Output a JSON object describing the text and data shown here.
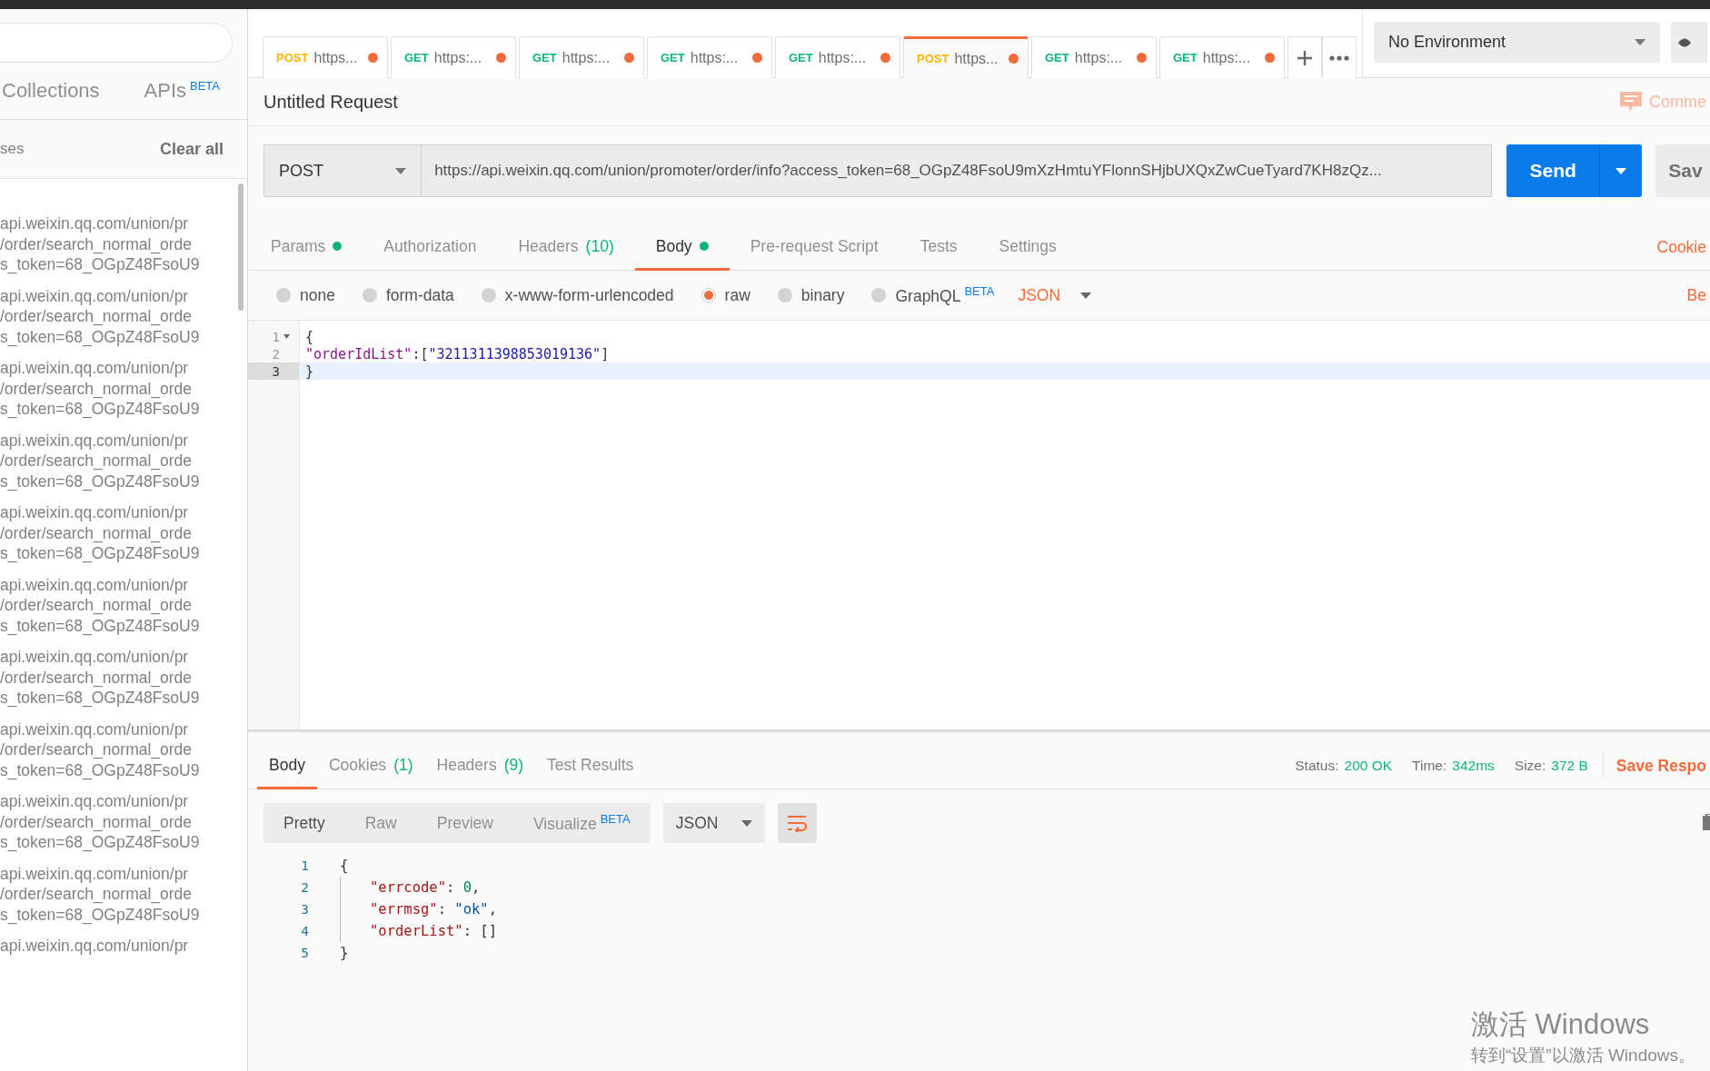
{
  "sidebar": {
    "tabs": [
      {
        "label": "Collections",
        "selected": false
      },
      {
        "label": "APIs",
        "badge": "BETA",
        "selected": false
      }
    ],
    "history_header": {
      "label": "ses",
      "action": "Clear all"
    },
    "items": [
      {
        "lines": [
          "api.weixin.qq.com/union/pr",
          "/order/search_normal_orde",
          "s_token=68_OGpZ48FsoU9"
        ]
      },
      {
        "lines": [
          "api.weixin.qq.com/union/pr",
          "/order/search_normal_orde",
          "s_token=68_OGpZ48FsoU9"
        ]
      },
      {
        "lines": [
          "api.weixin.qq.com/union/pr",
          "/order/search_normal_orde",
          "s_token=68_OGpZ48FsoU9"
        ]
      },
      {
        "lines": [
          "api.weixin.qq.com/union/pr",
          "/order/search_normal_orde",
          "s_token=68_OGpZ48FsoU9"
        ]
      },
      {
        "lines": [
          "api.weixin.qq.com/union/pr",
          "/order/search_normal_orde",
          "s_token=68_OGpZ48FsoU9"
        ]
      },
      {
        "lines": [
          "api.weixin.qq.com/union/pr",
          "/order/search_normal_orde",
          "s_token=68_OGpZ48FsoU9"
        ]
      },
      {
        "lines": [
          "api.weixin.qq.com/union/pr",
          "/order/search_normal_orde",
          "s_token=68_OGpZ48FsoU9"
        ]
      },
      {
        "lines": [
          "api.weixin.qq.com/union/pr",
          "/order/search_normal_orde",
          "s_token=68_OGpZ48FsoU9"
        ]
      },
      {
        "lines": [
          "api.weixin.qq.com/union/pr",
          "/order/search_normal_orde",
          "s_token=68_OGpZ48FsoU9"
        ]
      },
      {
        "lines": [
          "api.weixin.qq.com/union/pr",
          "/order/search_normal_orde",
          "s_token=68_OGpZ48FsoU9"
        ]
      },
      {
        "lines": [
          "api.weixin.qq.com/union/pr"
        ]
      }
    ]
  },
  "request_tabs": [
    {
      "method": "POST",
      "label": "https...",
      "unsaved": true,
      "selected": false
    },
    {
      "method": "GET",
      "label": "https:...",
      "unsaved": true,
      "selected": false
    },
    {
      "method": "GET",
      "label": "https:...",
      "unsaved": true,
      "selected": false
    },
    {
      "method": "GET",
      "label": "https:...",
      "unsaved": true,
      "selected": false
    },
    {
      "method": "GET",
      "label": "https:...",
      "unsaved": true,
      "selected": false
    },
    {
      "method": "POST",
      "label": "https...",
      "unsaved": true,
      "selected": true
    },
    {
      "method": "GET",
      "label": "https:...",
      "unsaved": true,
      "selected": false
    },
    {
      "method": "GET",
      "label": "https:...",
      "unsaved": true,
      "selected": false
    }
  ],
  "environment": "No Environment",
  "request": {
    "title": "Untitled Request",
    "comments": "Comme",
    "method": "POST",
    "url": "https://api.weixin.qq.com/union/promoter/order/info?access_token=68_OGpZ48FsoU9mXzHmtuYFlonnSHjbUXQxZwCueTyard7KH8zQz...",
    "send": "Send",
    "save": "Sav"
  },
  "request_sections": [
    {
      "label": "Params",
      "dot": true,
      "selected": false
    },
    {
      "label": "Authorization",
      "dot": false,
      "selected": false
    },
    {
      "label": "Headers",
      "count": "(10)",
      "dot": false,
      "selected": false
    },
    {
      "label": "Body",
      "dot": true,
      "selected": true
    },
    {
      "label": "Pre-request Script",
      "dot": false,
      "selected": false
    },
    {
      "label": "Tests",
      "dot": false,
      "selected": false
    },
    {
      "label": "Settings",
      "dot": false,
      "selected": false
    }
  ],
  "cookies_link": "Cookie",
  "body_types": [
    {
      "label": "none",
      "selected": false
    },
    {
      "label": "form-data",
      "selected": false
    },
    {
      "label": "x-www-form-urlencoded",
      "selected": false
    },
    {
      "label": "raw",
      "selected": true
    },
    {
      "label": "binary",
      "selected": false
    },
    {
      "label": "GraphQL",
      "badge": "BETA",
      "selected": false
    }
  ],
  "body_format": "JSON",
  "beautify": "Be",
  "request_body": [
    {
      "number": "1",
      "foldable": true,
      "highlighted": false,
      "tokens": [
        {
          "kind": "punct",
          "text": "{"
        }
      ]
    },
    {
      "number": "2",
      "foldable": false,
      "highlighted": false,
      "tokens": [
        {
          "kind": "key",
          "text": "\"orderIdList\""
        },
        {
          "kind": "punct",
          "text": ":["
        },
        {
          "kind": "string",
          "text": "\"3211311398853019136\""
        },
        {
          "kind": "punct",
          "text": "]"
        }
      ]
    },
    {
      "number": "3",
      "foldable": false,
      "highlighted": true,
      "tokens": [
        {
          "kind": "punct",
          "text": "}"
        }
      ]
    }
  ],
  "response_tabs": [
    {
      "label": "Body",
      "selected": true
    },
    {
      "label": "Cookies",
      "count": "(1)",
      "selected": false
    },
    {
      "label": "Headers",
      "count": "(9)",
      "selected": false
    },
    {
      "label": "Test Results",
      "selected": false
    }
  ],
  "response_meta": [
    {
      "label": "Status:",
      "value": "200 OK"
    },
    {
      "label": "Time:",
      "value": "342ms"
    },
    {
      "label": "Size:",
      "value": "372 B"
    }
  ],
  "save_response": "Save Respo",
  "view_modes": [
    {
      "label": "Pretty",
      "selected": true
    },
    {
      "label": "Raw",
      "selected": false
    },
    {
      "label": "Preview",
      "selected": false
    },
    {
      "label": "Visualize",
      "badge": "BETA",
      "selected": false
    }
  ],
  "response_format": "JSON",
  "response_body": [
    {
      "number": "1",
      "indented": false,
      "tokens": [
        {
          "kind": "punct",
          "text": "{"
        }
      ]
    },
    {
      "number": "2",
      "indented": true,
      "tokens": [
        {
          "kind": "rkey",
          "text": "\"errcode\""
        },
        {
          "kind": "punct",
          "text": ": "
        },
        {
          "kind": "number",
          "text": "0"
        },
        {
          "kind": "punct",
          "text": ","
        }
      ]
    },
    {
      "number": "3",
      "indented": true,
      "tokens": [
        {
          "kind": "rkey",
          "text": "\"errmsg\""
        },
        {
          "kind": "punct",
          "text": ": "
        },
        {
          "kind": "rstring",
          "text": "\"ok\""
        },
        {
          "kind": "punct",
          "text": ","
        }
      ]
    },
    {
      "number": "4",
      "indented": true,
      "tokens": [
        {
          "kind": "rkey",
          "text": "\"orderList\""
        },
        {
          "kind": "punct",
          "text": ": "
        },
        {
          "kind": "punct",
          "text": "[]"
        }
      ]
    },
    {
      "number": "5",
      "indented": false,
      "tokens": [
        {
          "kind": "punct",
          "text": "}"
        }
      ]
    }
  ],
  "os_notice": {
    "title": "激活 Windows",
    "subtitle": "转到“设置”以激活 Windows。"
  }
}
